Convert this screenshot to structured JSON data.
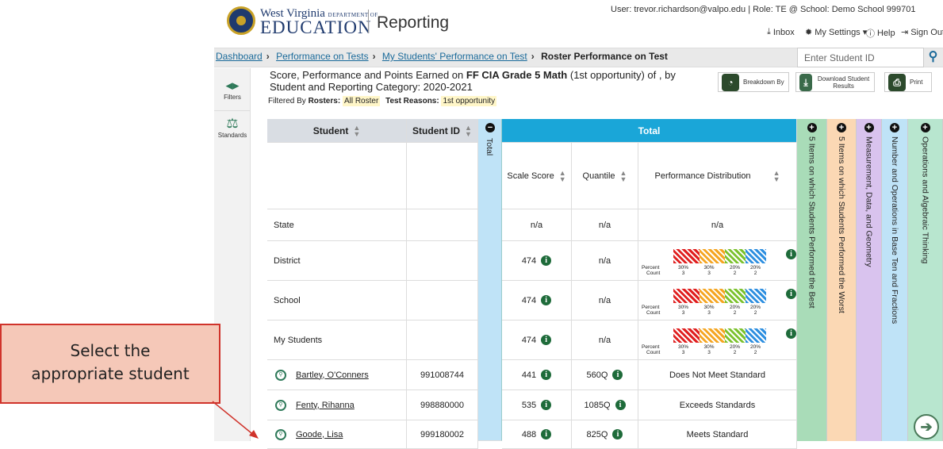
{
  "header": {
    "org_top": "West Virginia",
    "org_dept": "DEPARTMENT OF",
    "org_name": "EDUCATION",
    "app_title": "Reporting",
    "user_line": "User: trevor.richardson@valpo.edu | Role: TE @ School: Demo School 999701",
    "inbox": "Inbox",
    "settings": "My Settings ▾",
    "help": "Help",
    "signout": "Sign Out"
  },
  "breadcrumb": {
    "items": [
      "Dashboard",
      "Performance on Tests",
      "My Students' Performance on Test"
    ],
    "current": "Roster Performance on Test",
    "search_placeholder": "Enter Student ID"
  },
  "rail": {
    "filters": "Filters",
    "standards": "Standards"
  },
  "report": {
    "title_pre": "Score, Performance and Points Earned on ",
    "title_bold": "FF CIA Grade 5 Math",
    "title_post": " (1st opportunity) of , by Student and Reporting Category: 2020-2021",
    "filter_label": "Filtered By",
    "rosters_label": "Rosters:",
    "rosters_value": "All Roster",
    "reasons_label": "Test Reasons:",
    "reasons_value": "1st opportunity",
    "breakdown": "Breakdown By",
    "download": "Download Student Results",
    "print": "Print"
  },
  "table": {
    "col_student": "Student",
    "col_id": "Student ID",
    "col_total_vertical": "Total",
    "col_total": "Total",
    "col_scale": "Scale Score",
    "col_quantile": "Quantile",
    "col_dist": "Performance Distribution",
    "agg_rows": [
      {
        "name": "State",
        "scale": "n/a",
        "quantile": "n/a",
        "dist": "n/a"
      },
      {
        "name": "District",
        "scale": "474",
        "quantile": "n/a"
      },
      {
        "name": "School",
        "scale": "474",
        "quantile": "n/a"
      },
      {
        "name": "My Students",
        "scale": "474",
        "quantile": "n/a"
      }
    ],
    "dist_labels": {
      "percent": "Percent",
      "count": "Count"
    },
    "dist_percents": [
      "30%",
      "30%",
      "20%",
      "20%"
    ],
    "dist_counts": [
      "3",
      "3",
      "2",
      "2"
    ],
    "dist_colors": [
      "#e02020",
      "#f5a623",
      "#7cc22e",
      "#2e8fe0"
    ],
    "students": [
      {
        "name": "Bartley, O'Conners",
        "id": "991008744",
        "scale": "441",
        "quantile": "560Q",
        "level": "Does Not Meet Standard"
      },
      {
        "name": "Fenty, Rihanna",
        "id": "998880000",
        "scale": "535",
        "quantile": "1085Q",
        "level": "Exceeds Standards"
      },
      {
        "name": "Goode, Lisa",
        "id": "999180002",
        "scale": "488",
        "quantile": "825Q",
        "level": "Meets Standard"
      }
    ],
    "categories": [
      {
        "label": "5 Items on which Students Performed the Best",
        "color": "#a9dcb8"
      },
      {
        "label": "5 Items on which Students Performed the Worst",
        "color": "#fbd8b4"
      },
      {
        "label": "Measurement, Data, and Geometry",
        "color": "#d9c3ee"
      },
      {
        "label": "Number and Operations in Base Ten and Fractions",
        "color": "#bfe3f7"
      },
      {
        "label": "Operations and Algebraic Thinking",
        "color": "#b8e6cf"
      }
    ]
  },
  "callout": {
    "line1": "Select the",
    "line2": "appropriate student"
  }
}
